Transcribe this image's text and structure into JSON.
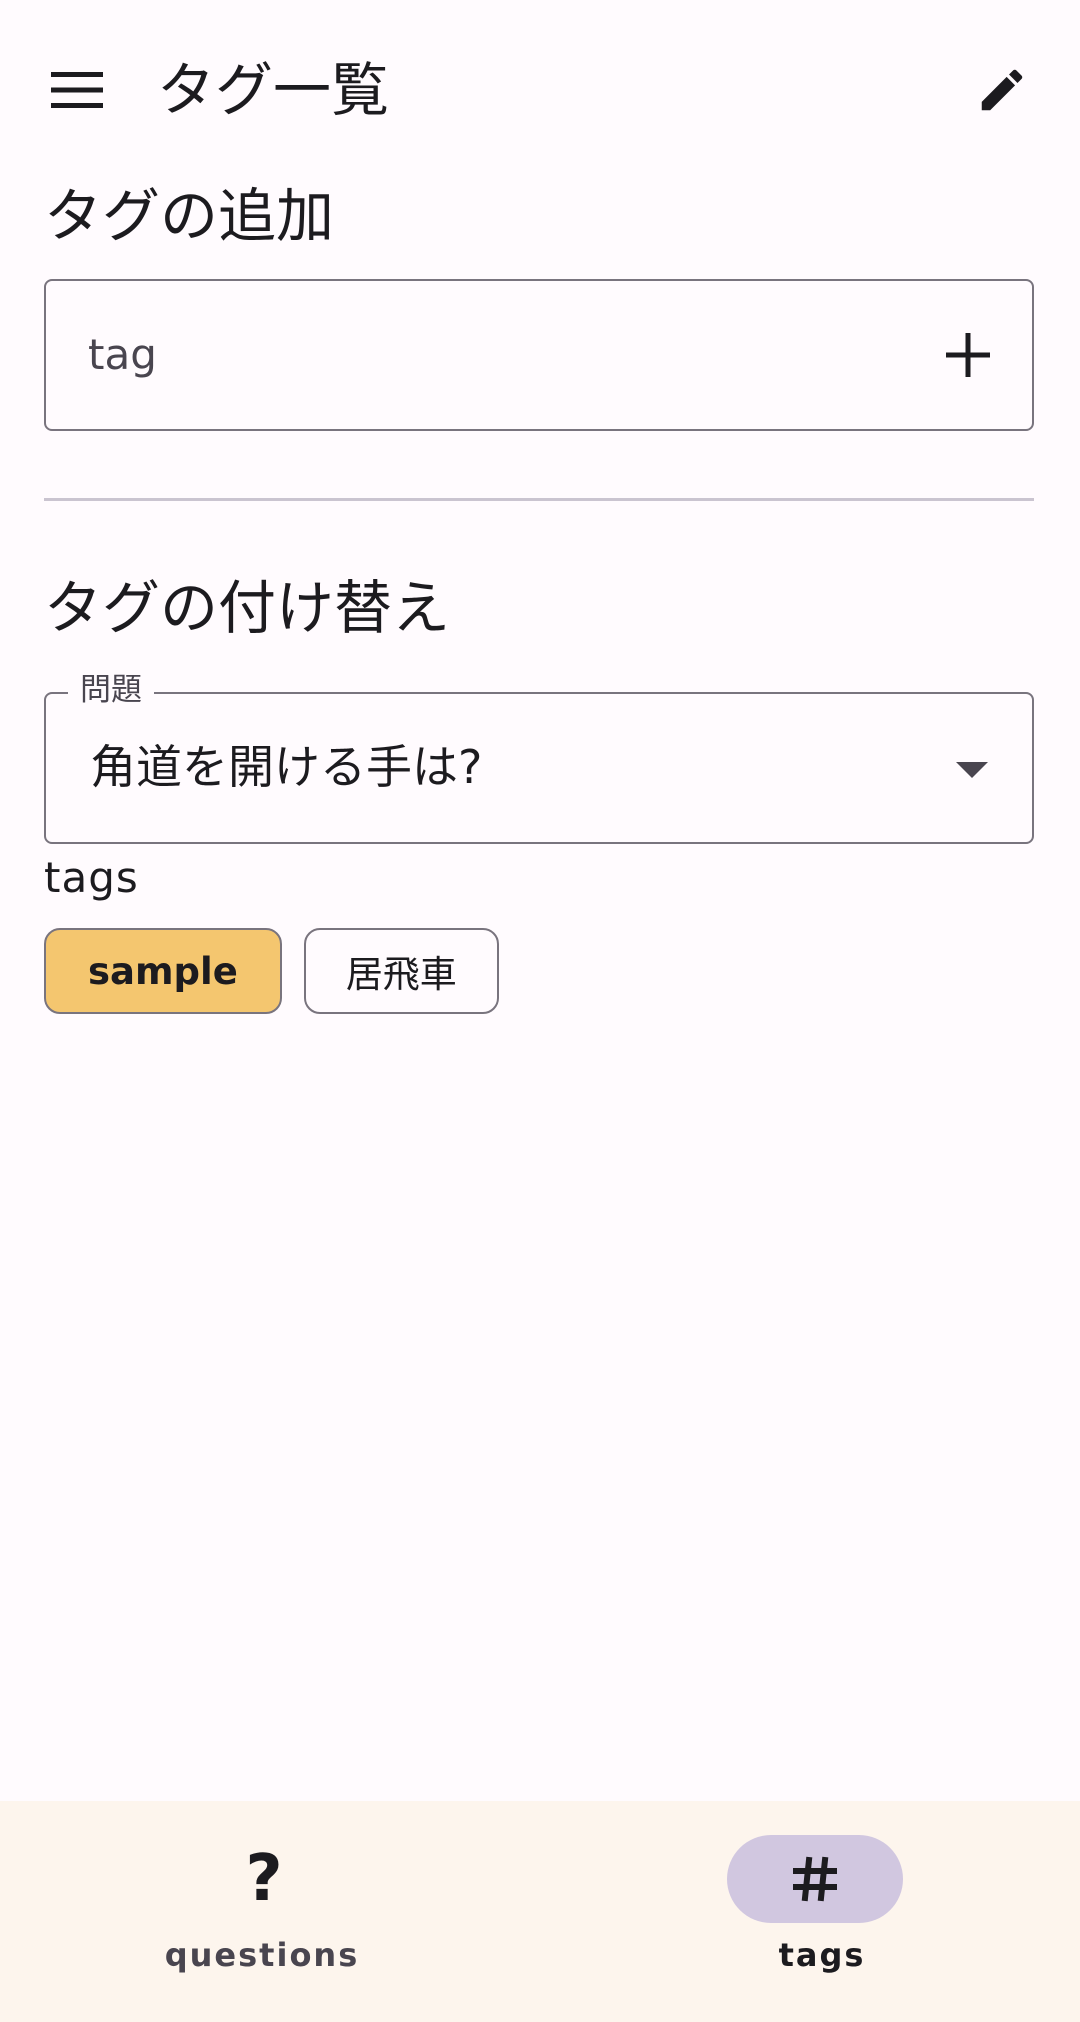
{
  "appbar": {
    "title": "タグ一覧",
    "menu_icon": "menu-icon",
    "edit_icon": "edit-icon"
  },
  "add_section": {
    "title": "タグの追加",
    "input_placeholder": "tag",
    "input_value": "",
    "add_icon": "add-icon"
  },
  "swap_section": {
    "title": "タグの付け替え",
    "select_label": "問題",
    "select_value": "角道を開ける手は?",
    "dropdown_icon": "arrow-drop-down-icon",
    "tags_label": "tags",
    "chips": [
      {
        "label": "sample",
        "selected": true
      },
      {
        "label": "居飛車",
        "selected": false
      }
    ]
  },
  "bottom_nav": {
    "items": [
      {
        "label": "questions",
        "icon": "question-mark-icon",
        "active": false
      },
      {
        "label": "tags",
        "icon": "tag-icon",
        "active": true
      }
    ]
  },
  "colors": {
    "background": "#fffbfe",
    "chip_selected": "#f4c66f",
    "nav_background": "#fdf5ed",
    "nav_indicator": "#d1c7e0",
    "outline": "#79747e"
  }
}
